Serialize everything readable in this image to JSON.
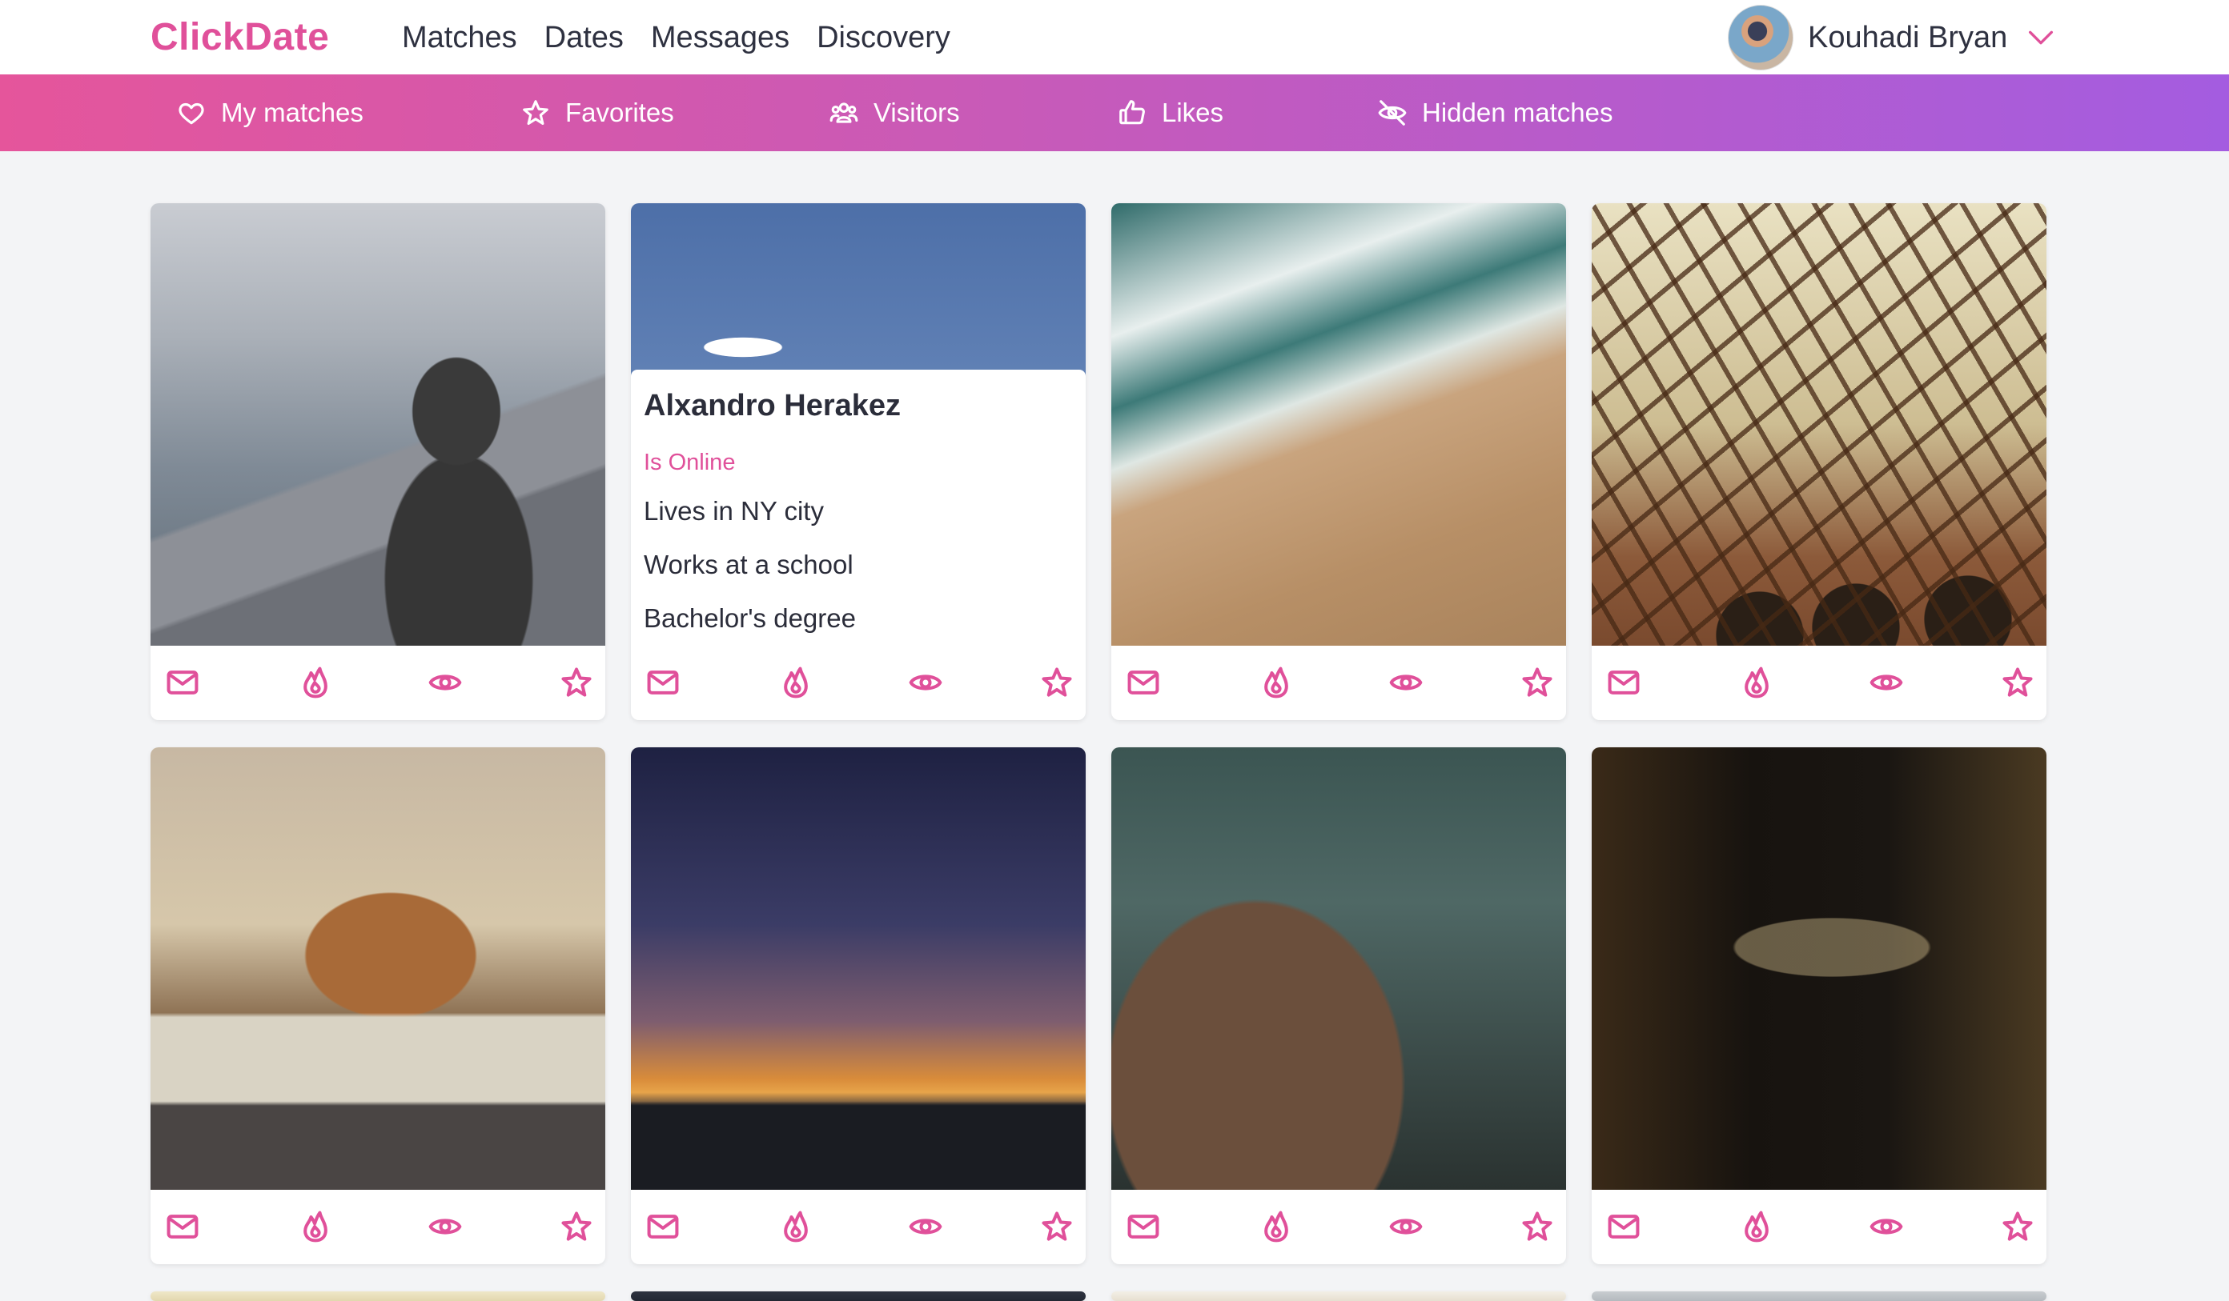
{
  "app": {
    "logo": "ClickDate"
  },
  "top_nav": [
    "Matches",
    "Dates",
    "Messages",
    "Discovery"
  ],
  "user": {
    "name": "Kouhadi Bryan",
    "menu_icon": "chevron-down-icon"
  },
  "sub_nav": [
    {
      "label": "My matches",
      "icon": "heart-icon"
    },
    {
      "label": "Favorites",
      "icon": "star-icon"
    },
    {
      "label": "Visitors",
      "icon": "users-icon"
    },
    {
      "label": "Likes",
      "icon": "thumbs-up-icon"
    },
    {
      "label": "Hidden matches",
      "icon": "eye-off-icon"
    }
  ],
  "colors": {
    "brand": "#e0509a",
    "gradient_start": "#e5559b",
    "gradient_end": "#a45ce0",
    "background": "#f3f4f6"
  },
  "profile_card": {
    "name": "Alxandro Herakez",
    "status": "Is Online",
    "details": [
      "Lives in NY city",
      "Works at a school",
      "Bachelor's degree"
    ]
  },
  "card_actions": [
    "mail-icon",
    "fire-icon",
    "eye-icon",
    "star-icon"
  ],
  "photos": [
    "person-in-hoodie-by-sea",
    "blue-sky-clouds",
    "beach-waves-aerial",
    "iron-bridge-arches",
    "sailboat-in-harbor",
    "sunset-pier",
    "cliffside-village",
    "night-street-lights",
    "photo-9",
    "photo-10",
    "photo-11",
    "photo-12"
  ]
}
